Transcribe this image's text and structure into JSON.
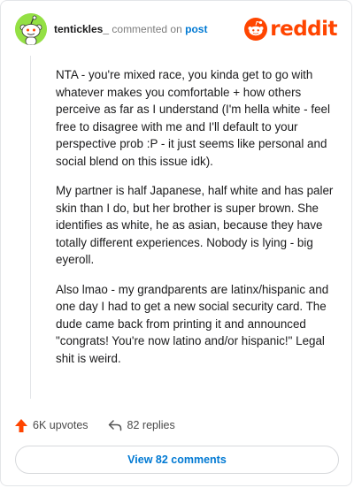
{
  "header": {
    "username": "tentickles_",
    "action_text": "commented on",
    "post_link": "post",
    "brand": "reddit"
  },
  "comment": {
    "paragraphs": [
      "NTA - you're mixed race, you kinda get to go with whatever makes you comfortable + how others perceive as far as I understand (I'm hella white - feel free to disagree with me and I'll default to your perspective prob :P - it just seems like personal and social blend on this issue idk).",
      "My partner is half Japanese, half white and has paler skin than I do, but her brother is super brown. She identifies as white, he as asian, because they have totally different experiences. Nobody is lying - big eyeroll.",
      "Also lmao - my grandparents are latinx/hispanic and one day I had to get a new social security card. The dude came back from printing it and announced \"congrats! You're now latino and/or hispanic!\" Legal shit is weird."
    ]
  },
  "actions": {
    "upvotes": "6K upvotes",
    "replies": "82 replies"
  },
  "view_button": "View 82 comments",
  "colors": {
    "brand": "#ff4500",
    "link": "#0079d3",
    "avatar_bg": "#94e044"
  }
}
